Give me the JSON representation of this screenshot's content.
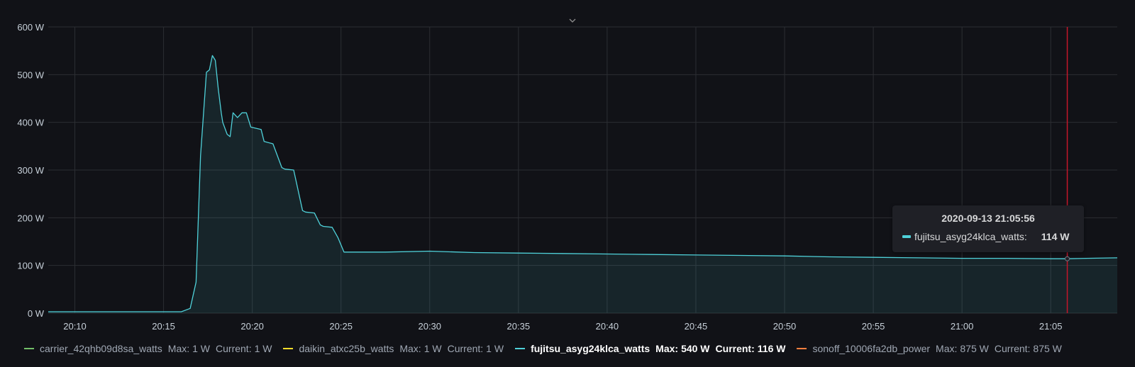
{
  "chart_data": {
    "type": "area",
    "y_unit": "W",
    "yticks": [
      "0 W",
      "100 W",
      "200 W",
      "300 W",
      "400 W",
      "500 W",
      "600 W"
    ],
    "ylim": [
      0,
      600
    ],
    "xticks": [
      "20:10",
      "20:15",
      "20:20",
      "20:25",
      "20:30",
      "20:35",
      "20:40",
      "20:45",
      "20:50",
      "20:55",
      "21:00",
      "21:05"
    ],
    "xlim": [
      "20:08:30",
      "21:08:45"
    ],
    "grid": true,
    "legend_position": "bottom",
    "series": [
      {
        "name": "fujitsu_asyg24klca_watts",
        "color": "#4fd1d9",
        "fill": true,
        "x": [
          "20:08:30",
          "20:16:00",
          "20:16:30",
          "20:16:50",
          "20:17:05",
          "20:17:25",
          "20:17:35",
          "20:17:45",
          "20:17:55",
          "20:18:05",
          "20:18:15",
          "20:18:20",
          "20:18:35",
          "20:18:45",
          "20:18:55",
          "20:19:10",
          "20:19:25",
          "20:19:40",
          "20:19:55",
          "20:20:30",
          "20:20:40",
          "20:21:10",
          "20:21:40",
          "20:21:50",
          "20:22:20",
          "20:22:50",
          "20:23:00",
          "20:23:30",
          "20:23:50",
          "20:24:00",
          "20:24:30",
          "20:24:50",
          "20:25:10",
          "20:27:30",
          "20:30:00",
          "20:32:30",
          "20:35:00",
          "20:37:30",
          "20:40:00",
          "20:42:30",
          "20:45:00",
          "20:47:30",
          "20:50:00",
          "20:52:30",
          "20:55:00",
          "20:57:30",
          "21:00:00",
          "21:02:30",
          "21:05:00",
          "21:05:56",
          "21:07:00",
          "21:08:45"
        ],
        "values": [
          3,
          3,
          10,
          65,
          330,
          505,
          510,
          540,
          530,
          470,
          420,
          400,
          375,
          370,
          420,
          410,
          420,
          420,
          390,
          385,
          360,
          355,
          305,
          302,
          300,
          215,
          212,
          210,
          185,
          182,
          180,
          158,
          128,
          128,
          130,
          127,
          126,
          125,
          124,
          123,
          122,
          121,
          120,
          118,
          117,
          116,
          115,
          115,
          114,
          114,
          115,
          116
        ]
      },
      {
        "name": "carrier_42qhb09d8sa_watts",
        "color": "#73bf69",
        "max": "1 W",
        "current": "1 W"
      },
      {
        "name": "daikin_atxc25b_watts",
        "color": "#fade2a",
        "max": "1 W",
        "current": "1 W"
      },
      {
        "name": "sonoff_10006fa2db_power",
        "color": "#ff7f3f",
        "max": "875 W",
        "current": "875 W"
      }
    ]
  },
  "hover_marker": {
    "time": "21:05:56",
    "color": "#c4162a"
  },
  "tooltip": {
    "timestamp": "2020-09-13 21:05:56",
    "series": "fujitsu_asyg24klca_watts:",
    "value": "114 W",
    "color": "#4fd1d9"
  },
  "legend": [
    {
      "name": "carrier_42qhb09d8sa_watts",
      "color": "#73bf69",
      "max_label": "Max:",
      "max": "1 W",
      "current_label": "Current:",
      "current": "1 W",
      "active": false
    },
    {
      "name": "daikin_atxc25b_watts",
      "color": "#fade2a",
      "max_label": "Max:",
      "max": "1 W",
      "current_label": "Current:",
      "current": "1 W",
      "active": false
    },
    {
      "name": "fujitsu_asyg24klca_watts",
      "color": "#4fd1d9",
      "max_label": "Max:",
      "max": "540 W",
      "current_label": "Current:",
      "current": "116 W",
      "active": true
    },
    {
      "name": "sonoff_10006fa2db_power",
      "color": "#ff7f3f",
      "max_label": "Max:",
      "max": "875 W",
      "current_label": "Current:",
      "current": "875 W",
      "active": false
    }
  ],
  "icons": {
    "collapse": "chevron-down-icon"
  }
}
